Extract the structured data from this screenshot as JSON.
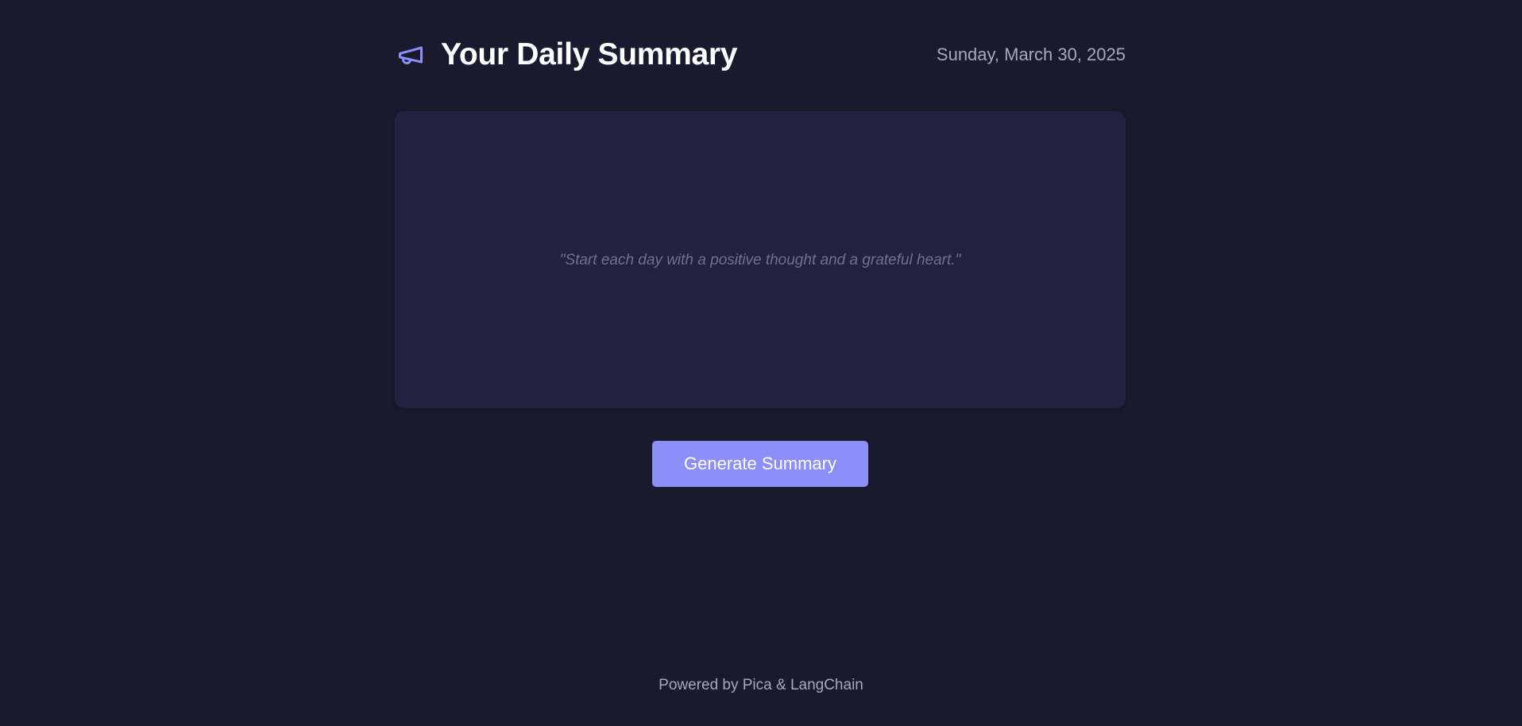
{
  "header": {
    "icon": "megaphone-icon",
    "title": "Your Daily Summary",
    "date": "Sunday, March 30, 2025"
  },
  "summary_card": {
    "quote": "\"Start each day with a positive thought and a grateful heart.\""
  },
  "actions": {
    "generate_label": "Generate Summary"
  },
  "footer": {
    "text": "Powered by Pica & LangChain"
  },
  "colors": {
    "background": "#1a1a2e",
    "card": "#222240",
    "accent": "#8b8ff7",
    "muted_text": "#a6a8bd",
    "quote_text": "#6f7190"
  }
}
